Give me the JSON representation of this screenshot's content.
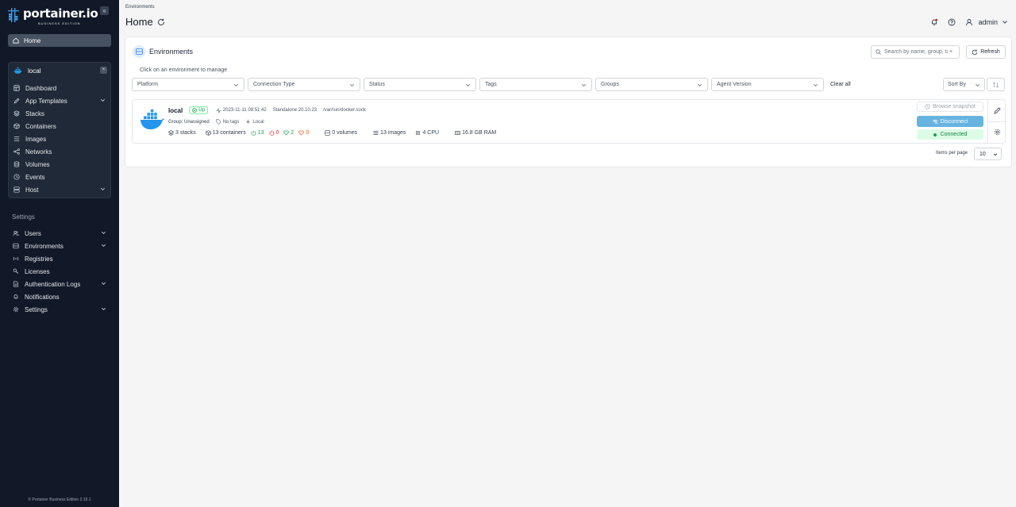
{
  "sidebar": {
    "brand": "portainer.io",
    "edition": "BUSINESS EDITION",
    "collapse": "«",
    "home_label": "Home",
    "environment": {
      "name": "local",
      "close": "×",
      "items": [
        {
          "label": "Dashboard",
          "icon": "dashboard-icon"
        },
        {
          "label": "App Templates",
          "icon": "edit-icon",
          "expandable": true
        },
        {
          "label": "Stacks",
          "icon": "stacks-icon"
        },
        {
          "label": "Containers",
          "icon": "box-icon"
        },
        {
          "label": "Images",
          "icon": "images-icon"
        },
        {
          "label": "Networks",
          "icon": "network-icon"
        },
        {
          "label": "Volumes",
          "icon": "database-icon"
        },
        {
          "label": "Events",
          "icon": "clock-icon"
        },
        {
          "label": "Host",
          "icon": "server-icon",
          "expandable": true
        }
      ]
    },
    "settings_title": "Settings",
    "settings_items": [
      {
        "label": "Users",
        "icon": "users-icon",
        "expandable": true
      },
      {
        "label": "Environments",
        "icon": "environments-icon",
        "expandable": true
      },
      {
        "label": "Registries",
        "icon": "radio-icon"
      },
      {
        "label": "Licenses",
        "icon": "key-icon"
      },
      {
        "label": "Authentication Logs",
        "icon": "file-icon",
        "expandable": true
      },
      {
        "label": "Notifications",
        "icon": "bell-icon"
      },
      {
        "label": "Settings",
        "icon": "gear-icon",
        "expandable": true
      }
    ],
    "footer": "© Portainer Business Edition 2.19.1"
  },
  "header": {
    "breadcrumb": "Environments",
    "title": "Home",
    "user": "admin"
  },
  "card": {
    "title": "Environments",
    "search_placeholder": "Search by name, group, tag...",
    "search_clear": "×",
    "refresh_label": "Refresh",
    "hint": "Click on an environment to manage",
    "filters": [
      "Platform",
      "Connection Type",
      "Status",
      "Tags",
      "Groups",
      "Agent Version"
    ],
    "clear_all": "Clear all",
    "sort_label": "Sort By",
    "items_per_page_label": "Items per page",
    "items_per_page_value": "10"
  },
  "environment_row": {
    "name": "local",
    "status": "Up",
    "timestamp": "2023-11-11 08:51:42",
    "type": "Standalone 20.10.23",
    "socket": "/var/run/docker.sock",
    "group": "Group: Unassigned",
    "tags": "No tags",
    "locality": "Local",
    "stacks": "3 stacks",
    "containers": "13 containers",
    "running": "13",
    "stopped": "0",
    "healthy": "2",
    "unhealthy": "0",
    "volumes": "0 volumes",
    "images": "13 images",
    "cpu": "4 CPU",
    "ram": "16.8 GB RAM",
    "browse_label": "Browse snapshot",
    "disconnect_label": "Disconnect",
    "connected_label": "Connected"
  },
  "colors": {
    "sidebar_bg": "#111827",
    "accent": "#66b3e0",
    "success": "#16a34a",
    "danger": "#dc2626",
    "warning": "#ea580c"
  }
}
